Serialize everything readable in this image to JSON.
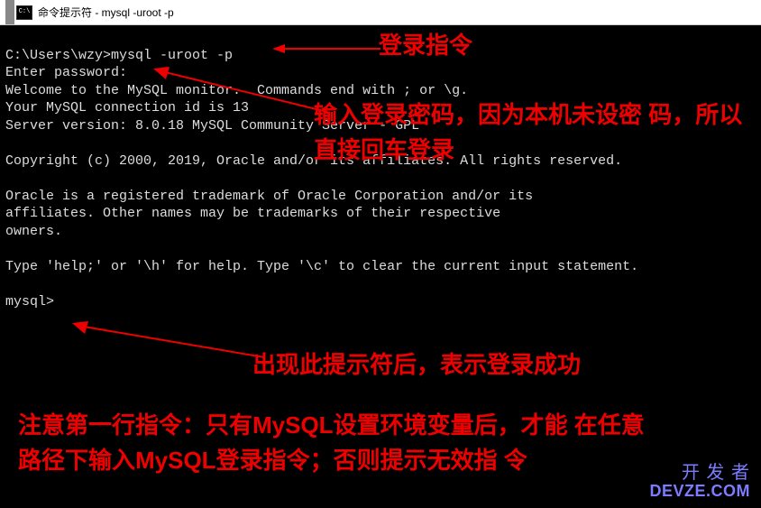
{
  "titlebar": {
    "text": "命令提示符 - mysql  -uroot -p"
  },
  "terminal": {
    "line1": "C:\\Users\\wzy>mysql -uroot -p",
    "line2": "Enter password:",
    "line3": "Welcome to the MySQL monitor.  Commands end with ; or \\g.",
    "line4": "Your MySQL connection id is 13",
    "line5": "Server version: 8.0.18 MySQL Community Server - GPL",
    "line6": "",
    "line7": "Copyright (c) 2000, 2019, Oracle and/or its affiliates. All rights reserved.",
    "line8": "",
    "line9": "Oracle is a registered trademark of Oracle Corporation and/or its",
    "line10": "affiliates. Other names may be trademarks of their respective",
    "line11": "owners.",
    "line12": "",
    "line13": "Type 'help;' or '\\h' for help. Type '\\c' to clear the current input statement.",
    "line14": "",
    "line15": "mysql>"
  },
  "annotations": {
    "login_cmd": "登录指令",
    "password": "输入登录密码，因为本机未设密\n码，所以直接回车登录",
    "prompt": "出现此提示符后，表示登录成功",
    "note": "注意第一行指令：只有MySQL设置环境变量后，才能\n在任意路径下输入MySQL登录指令；否则提示无效指\n令"
  },
  "watermark": {
    "line1": "开 发 者",
    "line2": "DEVZE.COM"
  }
}
